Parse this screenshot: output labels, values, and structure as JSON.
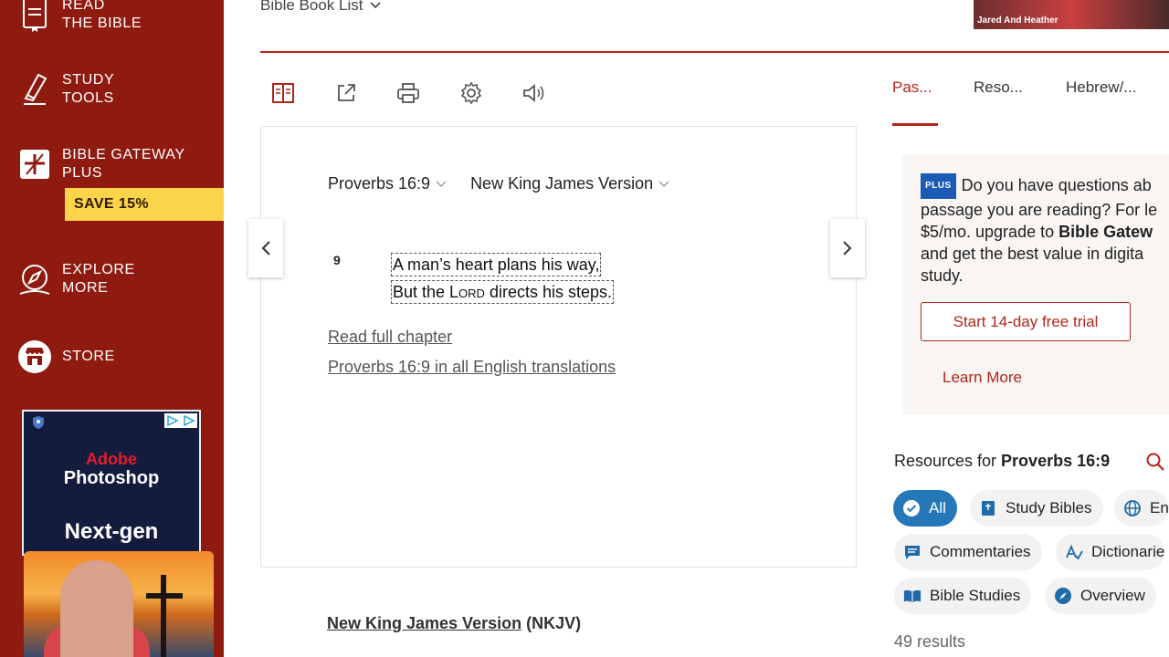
{
  "sidebar": {
    "items": [
      {
        "label": "READ\nTHE BIBLE",
        "icon": "bible-icon"
      },
      {
        "label": "STUDY\nTOOLS",
        "icon": "study-tools-icon"
      },
      {
        "label": "BIBLE GATEWAY\nPLUS",
        "icon": "plus-icon"
      },
      {
        "label": "EXPLORE\nMORE",
        "icon": "compass-icon"
      },
      {
        "label": "STORE",
        "icon": "store-icon"
      }
    ],
    "save_badge": "SAVE 15%",
    "ad": {
      "brand": "Adobe",
      "product": "Photoshop",
      "tagline": "Next-gen"
    }
  },
  "header": {
    "book_list": "Bible Book List",
    "webcam_name": "Jared And Heather"
  },
  "tabs": [
    {
      "label": "Pas...",
      "active": true
    },
    {
      "label": "Reso...",
      "active": false
    },
    {
      "label": "Hebrew/...",
      "active": false
    }
  ],
  "passage": {
    "reference": "Proverbs 16:9",
    "version": "New King James Version",
    "verse_number": "9",
    "line1": "A man’s heart plans his way,",
    "line2_pre": "But the ",
    "line2_lord": "Lord",
    "line2_post": " directs his steps.",
    "read_full_chapter": "Read full chapter",
    "all_translations": "Proverbs 16:9 in all English translations",
    "footer_version": "New King James Version",
    "footer_abbr": "(NKJV)"
  },
  "promo": {
    "badge": "PLUS",
    "line1": "Do you have questions ab",
    "line2": "passage you are reading? For le",
    "line3_pre": "$5/mo. upgrade to ",
    "line3_bold": "Bible Gatew",
    "line4": "and get the best value in digita",
    "line5": "study.",
    "trial_button": "Start 14-day free trial",
    "learn_more": "Learn More"
  },
  "resources": {
    "title_pre": "Resources for ",
    "title_ref": "Proverbs 16:9",
    "chips": [
      "All",
      "Study Bibles",
      "En",
      "Commentaries",
      "Dictionarie",
      "Bible Studies",
      "Overview"
    ],
    "results": "49 results"
  },
  "colors": {
    "brand_red": "#8f1a10",
    "accent_red": "#b2261a",
    "chip_blue": "#2677b8",
    "badge_yellow": "#fbd44a"
  }
}
